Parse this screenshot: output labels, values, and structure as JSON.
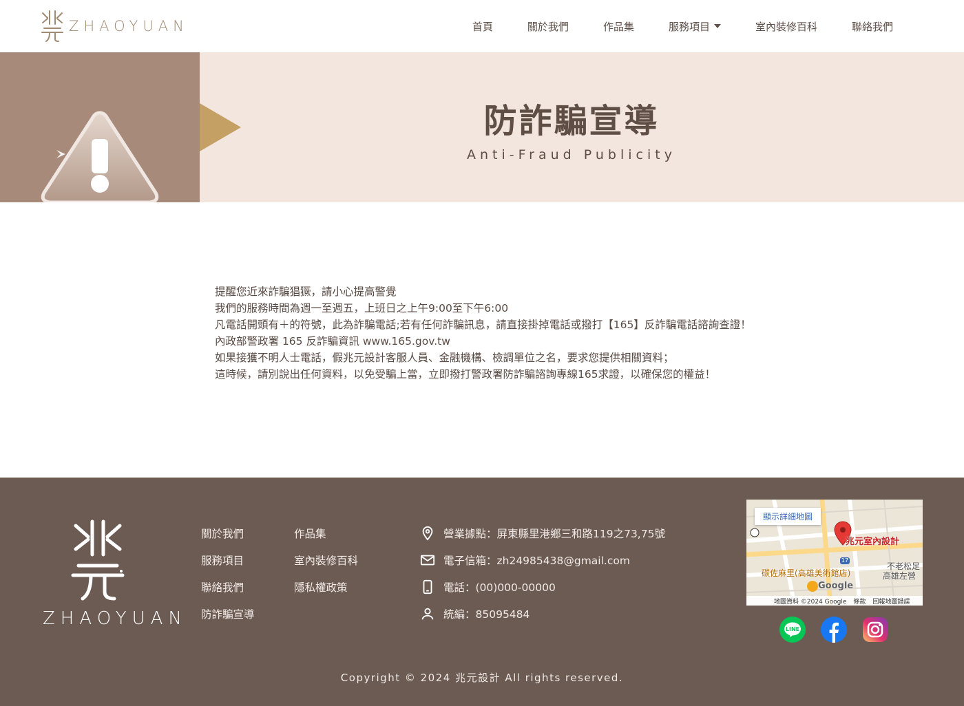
{
  "header": {
    "logo_text": "ZHAOYUAN",
    "nav": [
      {
        "label": "首頁"
      },
      {
        "label": "關於我們"
      },
      {
        "label": "作品集"
      },
      {
        "label": "服務項目"
      },
      {
        "label": "室內裝修百科"
      },
      {
        "label": "聯絡我們"
      }
    ]
  },
  "banner": {
    "title": "防詐騙宣導",
    "subtitle": "Anti-Fraud Publicity",
    "icon": "warning-triangle-icon"
  },
  "content": {
    "lines": [
      "提醒您近來詐騙猖獗，請小心提高警覺",
      "我們的服務時間為週一至週五，上班日之上午9:00至下午6:00",
      "凡電話開頭有＋的符號，此為詐騙電話;若有任何詐騙訊息，請直接掛掉電話或撥打【165】反詐騙電話諮詢查證！",
      "內政部警政署 165 反詐騙資訊 www.165.gov.tw",
      "如果接獲不明人士電話，假兆元設計客服人員、金融機構、檢調單位之名，要求您提供相關資料；",
      "這時候，請別說出任何資料，以免受騙上當，立即撥打警政署防詐騙諮詢專線165求證，以確保您的權益！"
    ]
  },
  "footer": {
    "logo_text": "ZHAOYUAN",
    "links": [
      {
        "label": "關於我們"
      },
      {
        "label": "作品集"
      },
      {
        "label": "服務項目"
      },
      {
        "label": "室內裝修百科"
      },
      {
        "label": "聯絡我們"
      },
      {
        "label": "隱私權政策"
      },
      {
        "label": "防詐騙宣導"
      }
    ],
    "info": {
      "address": "營業據點：屏東縣里港鄉三和路119之73,75號",
      "email": "電子信箱：zh24985438@gmail.com",
      "phone": "電話：(00)000-00000",
      "tax_id": "統編：85095484"
    },
    "map": {
      "button": "顯示詳細地圖",
      "pin_label": "兆元室內設計",
      "poi": "碳佐麻里(高雄美術館店)",
      "road_badge": "17",
      "google": "Google",
      "attribution": "地圖資料 ©2024 Google",
      "terms": "條款",
      "report": "回報地圖錯誤",
      "street_1": "不老松足",
      "street_2": "高雄左營"
    },
    "social": [
      {
        "name": "line-icon",
        "color": "#06c755"
      },
      {
        "name": "facebook-icon",
        "color": "#1877f2"
      },
      {
        "name": "instagram-icon",
        "color": "#d6249f"
      }
    ],
    "copyright": "Copyright © 2024 兆元設計 All rights reserved."
  }
}
